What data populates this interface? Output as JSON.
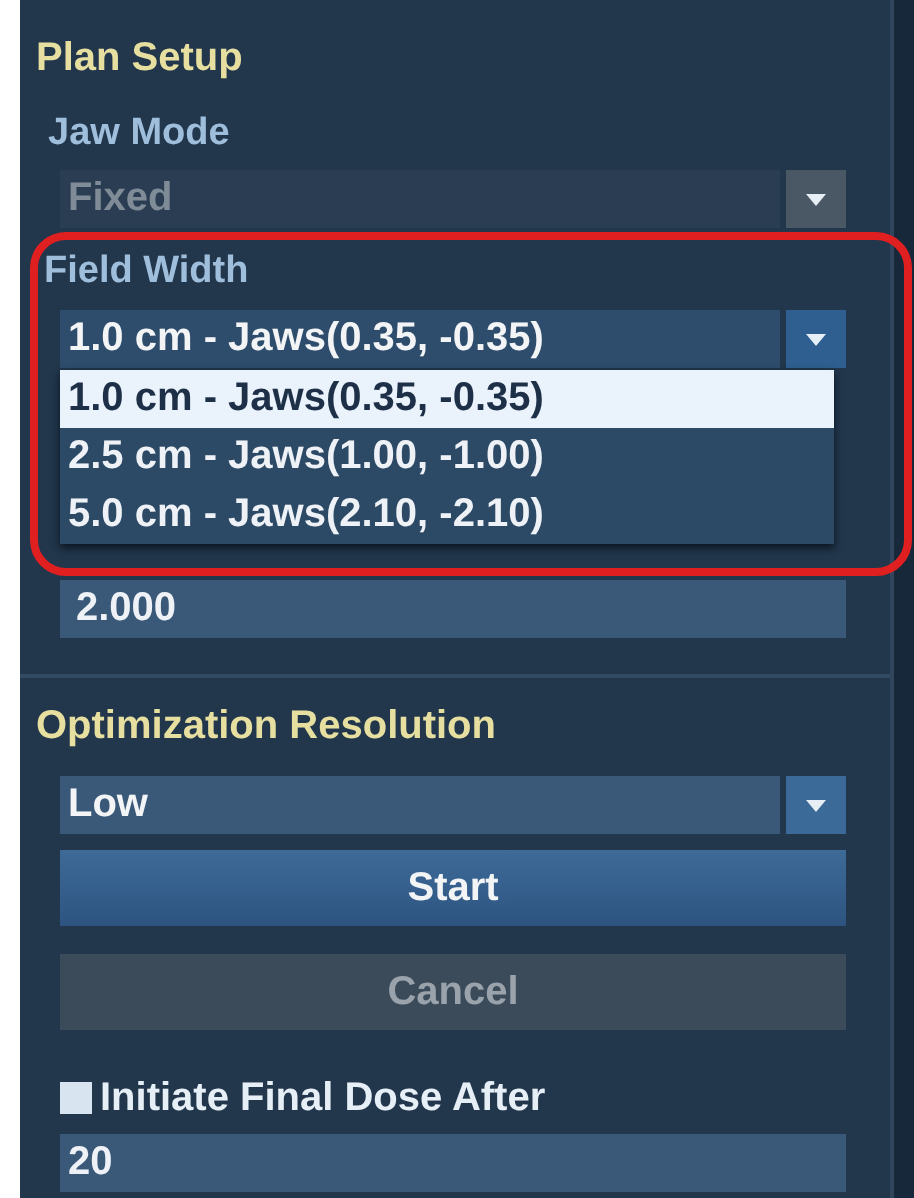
{
  "panel": {
    "title": "Plan Setup"
  },
  "jaw_mode": {
    "label": "Jaw Mode",
    "value": "Fixed",
    "disabled": true
  },
  "field_width": {
    "label": "Field Width",
    "value": "1.0 cm - Jaws(0.35, -0.35)",
    "expanded": true,
    "highlighted": true,
    "options": [
      {
        "label": "1.0 cm - Jaws(0.35, -0.35)",
        "selected": true
      },
      {
        "label": "2.5 cm - Jaws(1.00, -1.00)",
        "selected": false
      },
      {
        "label": "5.0 cm - Jaws(2.10, -2.10)",
        "selected": false
      }
    ]
  },
  "modulation_factor": {
    "value": "2.000"
  },
  "optimization": {
    "title": "Optimization Resolution",
    "value": "Low"
  },
  "buttons": [
    {
      "label": "Start",
      "disabled": false
    },
    {
      "label": "Cancel",
      "disabled": true
    }
  ],
  "final_dose": {
    "label": "Initiate Final Dose After",
    "checked": false,
    "value": "20"
  }
}
